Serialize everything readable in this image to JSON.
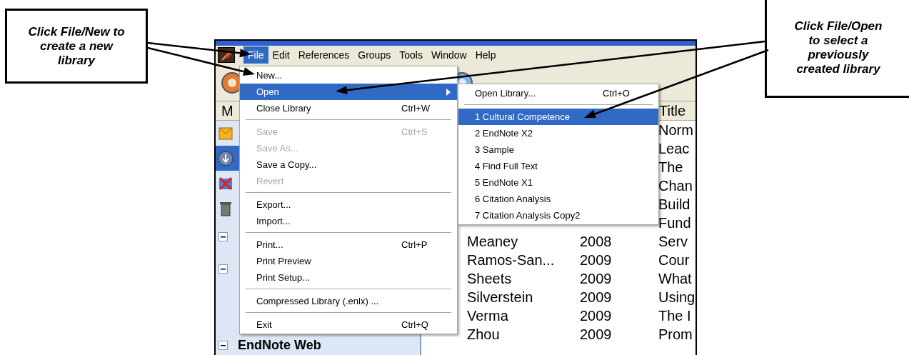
{
  "callouts": [
    {
      "text": "Click File/New to create a new library"
    },
    {
      "text": "Click File/Open to select a previously created library"
    }
  ],
  "menu_bar": [
    {
      "label": "File",
      "selected": true
    },
    {
      "label": "Edit",
      "selected": false
    },
    {
      "label": "References",
      "selected": false
    },
    {
      "label": "Groups",
      "selected": false
    },
    {
      "label": "Tools",
      "selected": false
    },
    {
      "label": "Window",
      "selected": false
    },
    {
      "label": "Help",
      "selected": false
    }
  ],
  "left_pane": {
    "header": "M",
    "items": [
      {
        "selected": false
      },
      {
        "selected": true
      },
      {
        "selected": false
      },
      {
        "selected": false
      }
    ],
    "groups": [
      {
        "expanded": true
      },
      {
        "expanded": true
      },
      {
        "expanded": true,
        "label": "EndNote Web"
      }
    ]
  },
  "reference_list": {
    "title_header": "Title",
    "rows": [
      {
        "title": "Norm"
      },
      {
        "title": "Leac"
      },
      {
        "title": "The"
      },
      {
        "title": "Chan"
      },
      {
        "title": "Build"
      },
      {
        "title": "Fund"
      },
      {
        "author": "Meaney",
        "year": "2008",
        "title": "Serv"
      },
      {
        "author": "Ramos-San...",
        "year": "2009",
        "title": "Cour"
      },
      {
        "author": "Sheets",
        "year": "2009",
        "title": "What"
      },
      {
        "author": "Silverstein",
        "year": "2009",
        "title": "Using"
      },
      {
        "author": "Verma",
        "year": "2009",
        "title": "The I"
      },
      {
        "author": "Zhou",
        "year": "2009",
        "title": "Prom"
      }
    ]
  },
  "file_menu": [
    {
      "kind": "item",
      "label": "New...",
      "disabled": false,
      "selected": false
    },
    {
      "kind": "submenu",
      "label": "Open",
      "disabled": false,
      "selected": true
    },
    {
      "kind": "item",
      "label": "Close Library",
      "shortcut": "Ctrl+W",
      "disabled": false,
      "selected": false
    },
    {
      "kind": "separator"
    },
    {
      "kind": "item",
      "label": "Save",
      "shortcut": "Ctrl+S",
      "disabled": true,
      "selected": false
    },
    {
      "kind": "item",
      "label": "Save As...",
      "disabled": true,
      "selected": false
    },
    {
      "kind": "item",
      "label": "Save a Copy...",
      "disabled": false,
      "selected": false
    },
    {
      "kind": "item",
      "label": "Revert",
      "disabled": true,
      "selected": false
    },
    {
      "kind": "separator"
    },
    {
      "kind": "item",
      "label": "Export...",
      "disabled": false,
      "selected": false
    },
    {
      "kind": "item",
      "label": "Import...",
      "disabled": false,
      "selected": false
    },
    {
      "kind": "separator"
    },
    {
      "kind": "item",
      "label": "Print...",
      "shortcut": "Ctrl+P",
      "disabled": false,
      "selected": false
    },
    {
      "kind": "item",
      "label": "Print Preview",
      "disabled": false,
      "selected": false
    },
    {
      "kind": "item",
      "label": "Print Setup...",
      "disabled": false,
      "selected": false
    },
    {
      "kind": "separator"
    },
    {
      "kind": "item",
      "label": "Compressed Library (.enlx) ...",
      "disabled": false,
      "selected": false
    },
    {
      "kind": "separator"
    },
    {
      "kind": "item",
      "label": "Exit",
      "shortcut": "Ctrl+Q",
      "disabled": false,
      "selected": false
    }
  ],
  "open_submenu": [
    {
      "kind": "item",
      "label": "Open Library...",
      "shortcut": "Ctrl+O",
      "selected": false
    },
    {
      "kind": "separator"
    },
    {
      "kind": "item",
      "label": "1 Cultural Competence",
      "selected": true
    },
    {
      "kind": "item",
      "label": "2 EndNote X2",
      "selected": false
    },
    {
      "kind": "item",
      "label": "3 Sample",
      "selected": false
    },
    {
      "kind": "item",
      "label": "4 Find Full Text",
      "selected": false
    },
    {
      "kind": "item",
      "label": "5 EndNote X1",
      "selected": false
    },
    {
      "kind": "item",
      "label": "6 Citation Analysis",
      "selected": false
    },
    {
      "kind": "item",
      "label": "7 Citation Analysis Copy2",
      "selected": false
    }
  ]
}
